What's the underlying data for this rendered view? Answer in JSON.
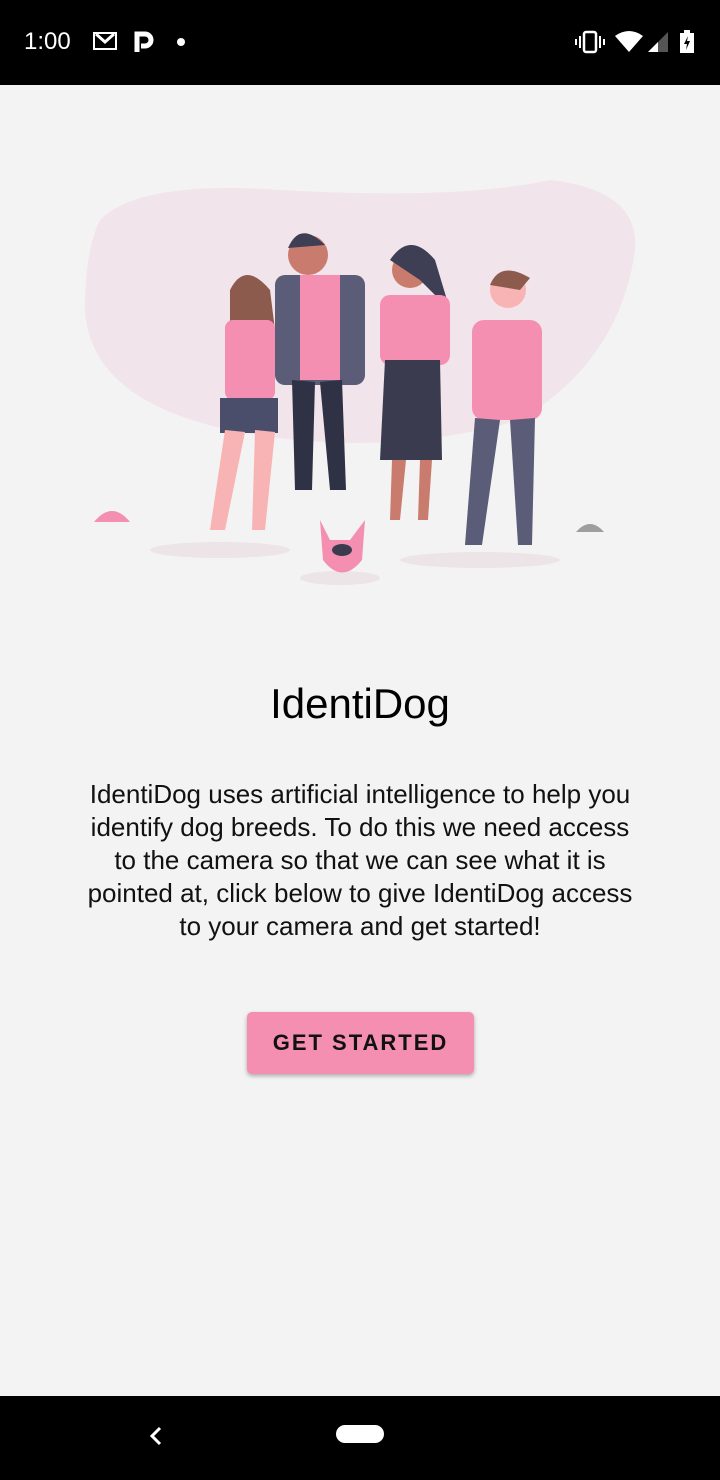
{
  "status_bar": {
    "time": "1:00"
  },
  "app": {
    "title": "IdentiDog",
    "description": "IdentiDog uses artificial intelligence to help you identify dog breeds. To do this we need access to the camera so that we can see what it is pointed at, click below to give IdentiDog access to your camera and get started!",
    "button_label": "GET STARTED",
    "accent": "#f48fb1"
  }
}
